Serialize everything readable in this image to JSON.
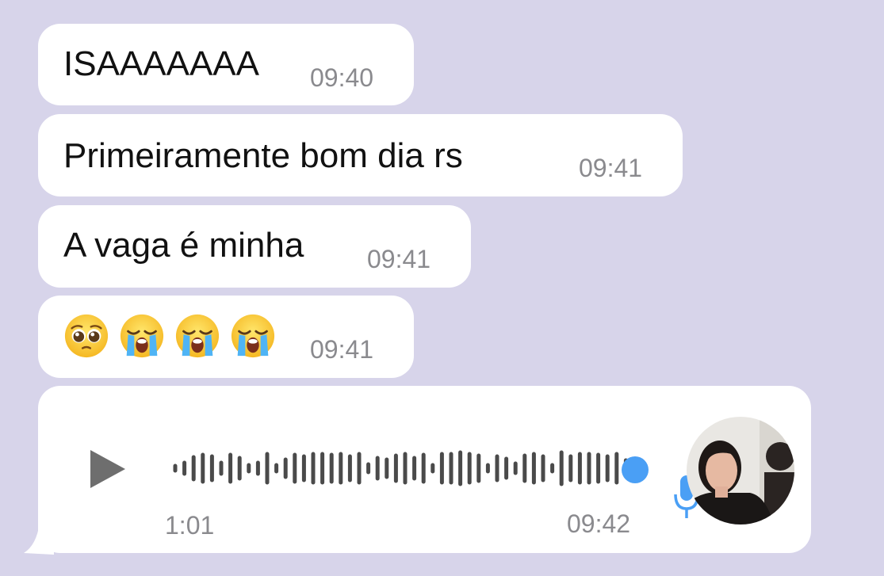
{
  "messages": [
    {
      "text": "ISAAAAAAA",
      "time": "09:40"
    },
    {
      "text": "Primeiramente bom dia rs",
      "time": "09:41"
    },
    {
      "text": "A vaga é minha",
      "time": "09:41"
    },
    {
      "emojis": [
        "pleading-face",
        "loudly-crying-face",
        "loudly-crying-face",
        "loudly-crying-face"
      ],
      "time": "09:41"
    }
  ],
  "voice_message": {
    "duration": "1:01",
    "time": "09:42",
    "progress": 1.0,
    "accent_color": "#4a9ff5"
  },
  "colors": {
    "background": "#d7d4ea",
    "bubble": "#ffffff",
    "timestamp": "#8a8a8e"
  }
}
